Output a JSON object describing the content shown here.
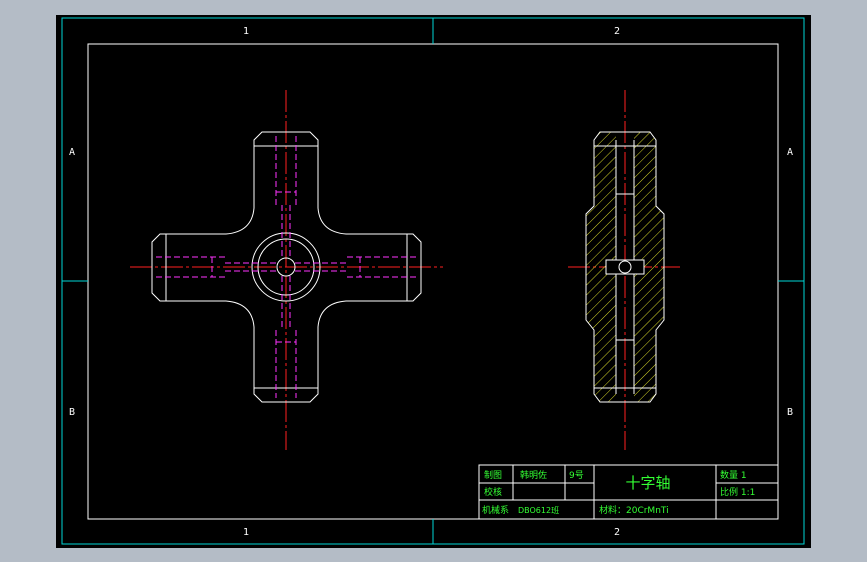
{
  "drawing": {
    "colors": {
      "background": "#000000",
      "window": "#b4bcc6",
      "frame": "#ffffff",
      "grid": "#00d6d6",
      "outline": "#ffffff",
      "hidden": "#ff33ff",
      "center": "#ff2020",
      "hatch": "#d6d62a",
      "text": "#33ff33"
    },
    "zones": {
      "top_left": "1",
      "top_right": "2",
      "bottom_left": "1",
      "bottom_right": "2",
      "left_upper": "A",
      "left_lower": "B",
      "right_upper": "A",
      "right_lower": "B"
    }
  },
  "title_block": {
    "drawn_label": "制图",
    "drawn_by": "韩明佐",
    "sheet_no": "9号",
    "check_label": "校核",
    "part_name": "十字轴",
    "quantity": "数量  1",
    "scale": "比例 1:1",
    "school": "机械系",
    "class_id": "DBO612班",
    "material": "材料：20CrMnTi"
  }
}
